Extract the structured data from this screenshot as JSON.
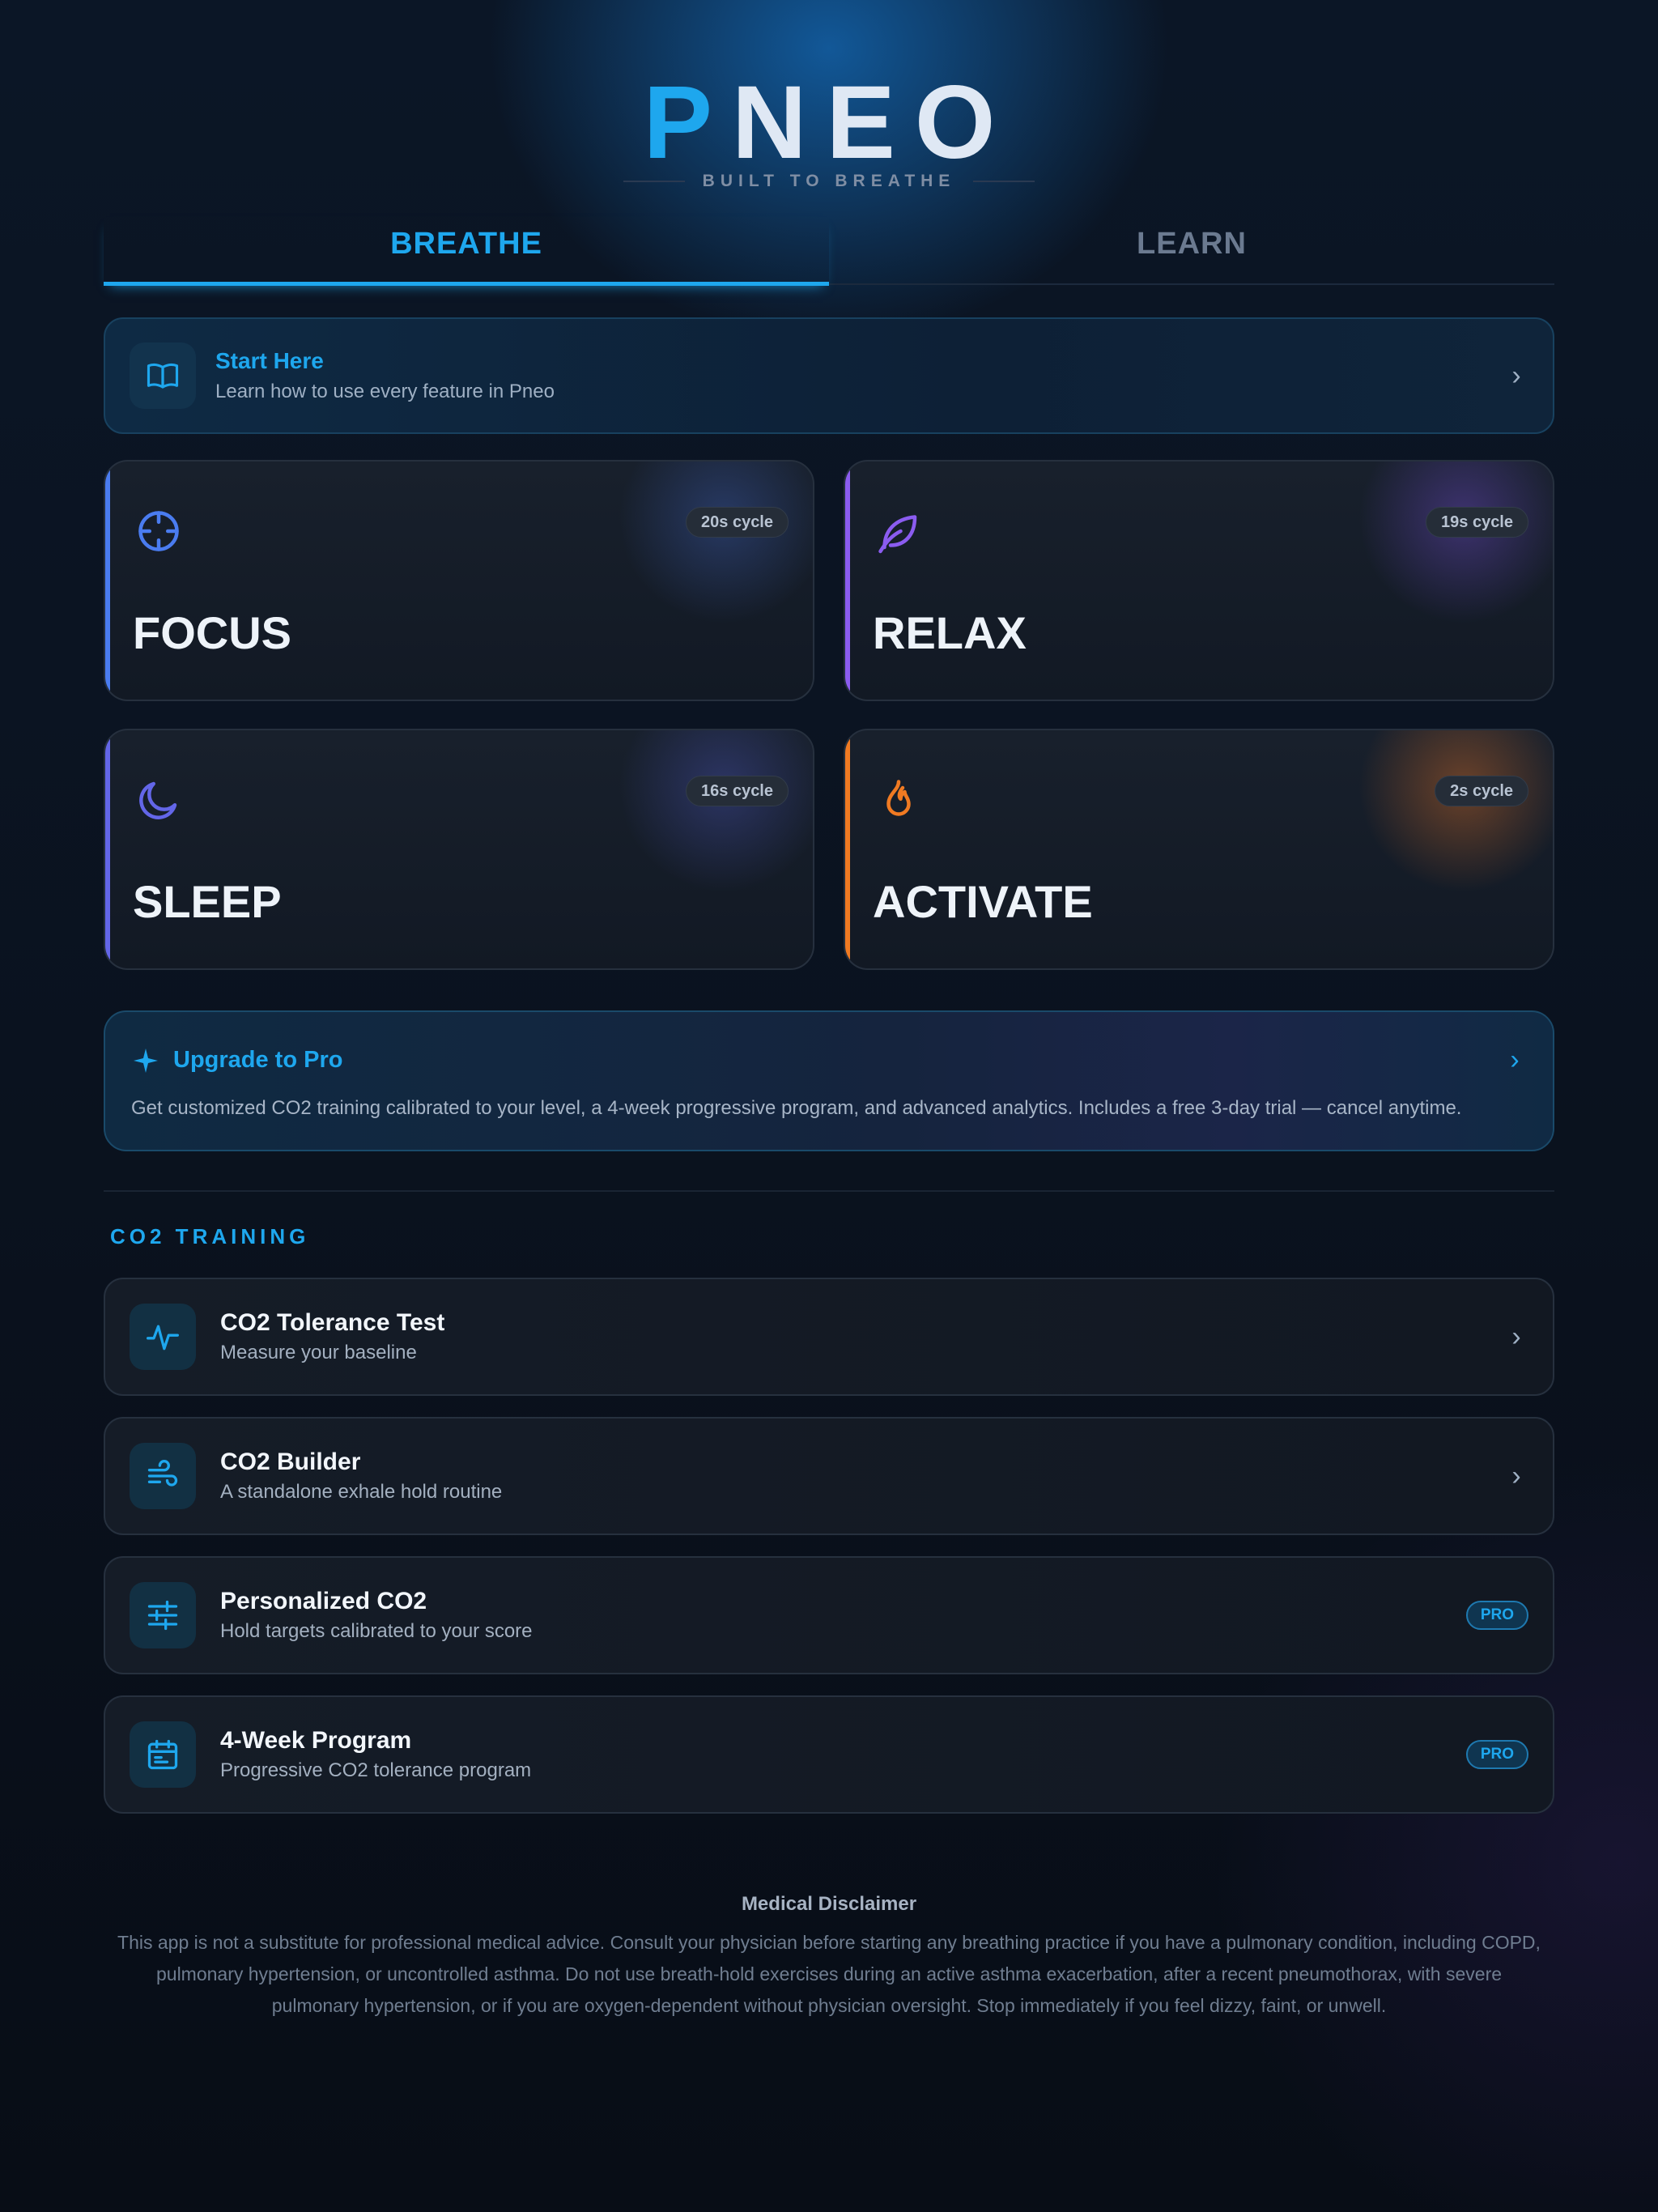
{
  "header": {
    "logo_first": "P",
    "logo_rest": "NEO",
    "tagline": "BUILT TO BREATHE"
  },
  "tabs": [
    {
      "label": "BREATHE",
      "active": true
    },
    {
      "label": "LEARN",
      "active": false
    }
  ],
  "start_here": {
    "title": "Start Here",
    "subtitle": "Learn how to use every feature in Pneo",
    "icon": "book-icon"
  },
  "modes": [
    {
      "name": "FOCUS",
      "cycle": "20s cycle",
      "icon": "crosshair-icon",
      "color": "#4a7cf0"
    },
    {
      "name": "RELAX",
      "cycle": "19s cycle",
      "icon": "leaf-icon",
      "color": "#8b5cf0"
    },
    {
      "name": "SLEEP",
      "cycle": "16s cycle",
      "icon": "moon-icon",
      "color": "#6366e8"
    },
    {
      "name": "ACTIVATE",
      "cycle": "2s cycle",
      "icon": "flame-icon",
      "color": "#f07a22"
    }
  ],
  "upgrade": {
    "title": "Upgrade to Pro",
    "description": "Get customized CO2 training calibrated to your level, a 4-week progressive program, and advanced analytics. Includes a free 3-day trial — cancel anytime.",
    "icon": "sparkle-icon"
  },
  "co2": {
    "heading": "CO2 TRAINING",
    "items": [
      {
        "title": "CO2 Tolerance Test",
        "subtitle": "Measure your baseline",
        "icon": "pulse-icon",
        "pro": false
      },
      {
        "title": "CO2 Builder",
        "subtitle": "A standalone exhale hold routine",
        "icon": "wind-icon",
        "pro": false
      },
      {
        "title": "Personalized CO2",
        "subtitle": "Hold targets calibrated to your score",
        "icon": "sliders-icon",
        "pro": true,
        "badge": "PRO"
      },
      {
        "title": "4-Week Program",
        "subtitle": "Progressive CO2 tolerance program",
        "icon": "calendar-icon",
        "pro": true,
        "badge": "PRO"
      }
    ]
  },
  "disclaimer": {
    "title": "Medical Disclaimer",
    "text": "This app is not a substitute for professional medical advice. Consult your physician before starting any breathing practice if you have a pulmonary condition, including COPD, pulmonary hypertension, or uncontrolled asthma. Do not use breath-hold exercises during an active asthma exacerbation, after a recent pneumothorax, with severe pulmonary hypertension, or if you are oxygen-dependent without physician oversight. Stop immediately if you feel dizzy, faint, or unwell."
  },
  "colors": {
    "accent": "#1ea7ee",
    "background": "#0b1422"
  }
}
